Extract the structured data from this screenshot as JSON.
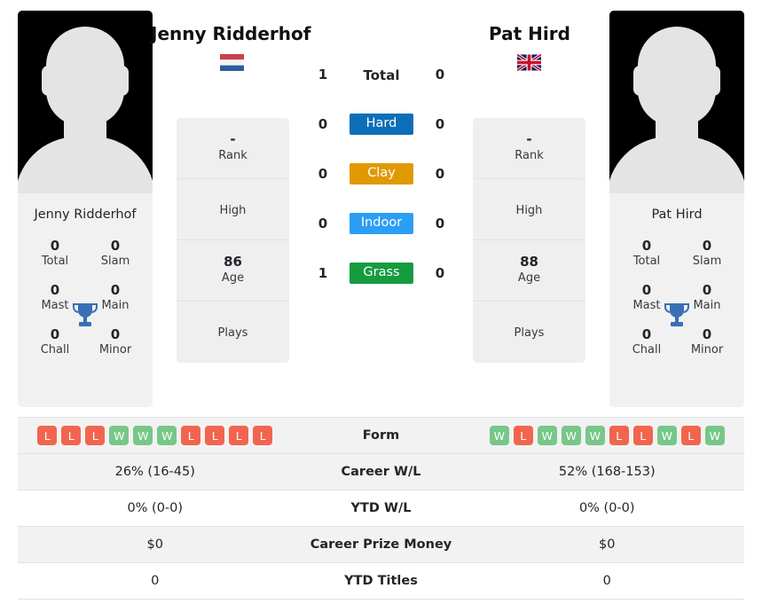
{
  "players": {
    "left": {
      "name": "Jenny Ridderhof",
      "photo_caption": "Jenny Ridderhof",
      "country": "Netherlands",
      "flag": "nl-flag-icon",
      "titles": {
        "total_value": "0",
        "total_label": "Total",
        "slam_value": "0",
        "slam_label": "Slam",
        "mast_value": "0",
        "mast_label": "Mast",
        "main_value": "0",
        "main_label": "Main",
        "chall_value": "0",
        "chall_label": "Chall",
        "minor_value": "0",
        "minor_label": "Minor"
      },
      "meta": [
        {
          "value": "-",
          "label": "Rank"
        },
        {
          "value": "",
          "label": "High"
        },
        {
          "value": "86",
          "label": "Age"
        },
        {
          "value": "",
          "label": "Plays"
        }
      ],
      "form": [
        "L",
        "L",
        "L",
        "W",
        "W",
        "W",
        "L",
        "L",
        "L",
        "L"
      ],
      "career_wl": "26% (16-45)",
      "ytd_wl": "0% (0-0)",
      "career_prize_money": "$0",
      "ytd_titles": "0"
    },
    "right": {
      "name": "Pat Hird",
      "photo_caption": "Pat Hird",
      "country": "United Kingdom",
      "flag": "gb-flag-icon",
      "titles": {
        "total_value": "0",
        "total_label": "Total",
        "slam_value": "0",
        "slam_label": "Slam",
        "mast_value": "0",
        "mast_label": "Mast",
        "main_value": "0",
        "main_label": "Main",
        "chall_value": "0",
        "chall_label": "Chall",
        "minor_value": "0",
        "minor_label": "Minor"
      },
      "meta": [
        {
          "value": "-",
          "label": "Rank"
        },
        {
          "value": "",
          "label": "High"
        },
        {
          "value": "88",
          "label": "Age"
        },
        {
          "value": "",
          "label": "Plays"
        }
      ],
      "form": [
        "W",
        "L",
        "W",
        "W",
        "W",
        "L",
        "L",
        "W",
        "L",
        "W"
      ],
      "career_wl": "52% (168-153)",
      "ytd_wl": "0% (0-0)",
      "career_prize_money": "$0",
      "ytd_titles": "0"
    }
  },
  "head_to_head": [
    {
      "label": "Total",
      "left": "1",
      "right": "0",
      "type": "total",
      "color": ""
    },
    {
      "label": "Hard",
      "left": "0",
      "right": "0",
      "type": "surface",
      "color": "#0d6eb8"
    },
    {
      "label": "Clay",
      "left": "0",
      "right": "0",
      "type": "surface",
      "color": "#e09900"
    },
    {
      "label": "Indoor",
      "left": "0",
      "right": "0",
      "type": "surface",
      "color": "#2b9ef5"
    },
    {
      "label": "Grass",
      "left": "1",
      "right": "0",
      "type": "surface",
      "color": "#169b3f"
    }
  ],
  "stats_rows": [
    {
      "label": "Form",
      "key": "form"
    },
    {
      "label": "Career W/L",
      "key": "career_wl"
    },
    {
      "label": "YTD W/L",
      "key": "ytd_wl"
    },
    {
      "label": "Career Prize Money",
      "key": "career_prize_money"
    },
    {
      "label": "YTD Titles",
      "key": "ytd_titles"
    }
  ],
  "colors": {
    "hard": "#0d6eb8",
    "clay": "#e09900",
    "indoor": "#2b9ef5",
    "grass": "#169b3f",
    "win_badge": "#77c788",
    "loss_badge": "#f1654f",
    "trophy": "#3a6eb5",
    "card_bg": "#f1f1f1"
  }
}
